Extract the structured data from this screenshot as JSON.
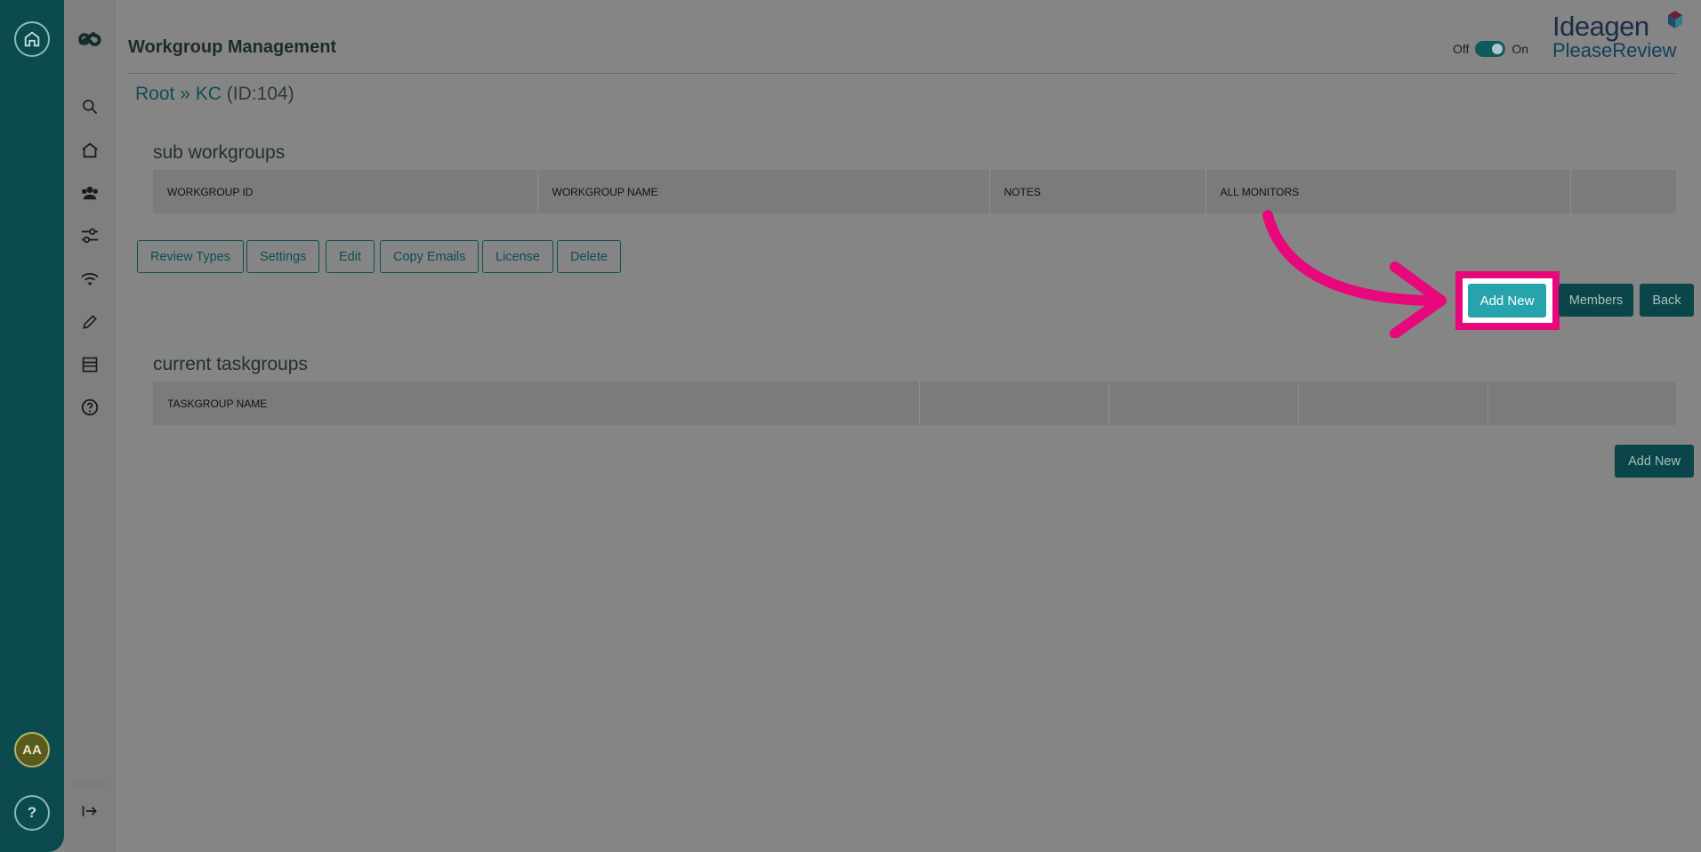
{
  "header": {
    "title": "Workgroup Management",
    "toggle_off": "Off",
    "toggle_on": "On",
    "logo_main": "Ideagen",
    "logo_sub": "PleaseReview"
  },
  "rail": {
    "avatar_initials": "AA",
    "help_label": "?"
  },
  "breadcrumb": {
    "root": "Root",
    "separator": " » ",
    "current": "KC",
    "id_text": " (ID:104)"
  },
  "sub_workgroups": {
    "title": "sub workgroups",
    "columns": [
      "WORKGROUP ID",
      "WORKGROUP NAME",
      "NOTES",
      "ALL MONITORS",
      ""
    ]
  },
  "action_buttons": [
    "Review Types",
    "Settings",
    "Edit",
    "Copy Emails",
    "License",
    "Delete"
  ],
  "workgroup_buttons": {
    "add_new": "Add New",
    "members": "Members",
    "back": "Back"
  },
  "current_taskgroups": {
    "title": "current taskgroups",
    "columns": [
      "TASKGROUP NAME",
      "",
      "",
      "",
      ""
    ],
    "add_new": "Add New"
  },
  "colors": {
    "rail": "#0b4b4d",
    "accent": "#27a3ab",
    "highlight": "#e8087c"
  }
}
